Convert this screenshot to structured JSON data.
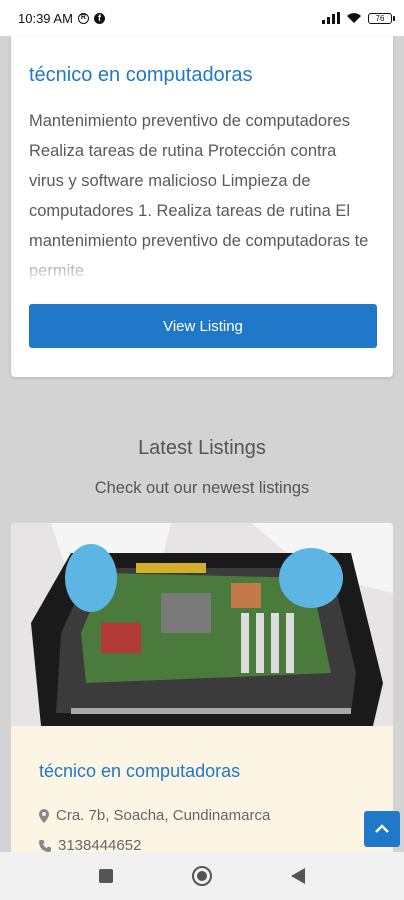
{
  "status_bar": {
    "time": "10:39 AM",
    "battery": "76"
  },
  "top_card": {
    "title": "técnico en computadoras",
    "description": "Mantenimiento preventivo de computadores Realiza tareas de rutina Protección contra virus y software malicioso Limpieza de computadores 1. Realiza tareas de rutina El mantenimiento preventivo de computadoras te permite",
    "button_label": "View Listing"
  },
  "latest": {
    "heading": "Latest Listings",
    "subheading": "Check out our newest listings"
  },
  "listing": {
    "title": "técnico en computadoras",
    "address": "Cra. 7b, Soacha, Cundinamarca",
    "phone": "3138444652"
  },
  "colors": {
    "accent": "#1f78c8",
    "page_background": "#d3d3d3",
    "listing_background": "#fdf5e4"
  },
  "icons": {
    "address": "map-marker-icon",
    "phone": "phone-icon",
    "scroll_top": "chevron-up-icon"
  }
}
